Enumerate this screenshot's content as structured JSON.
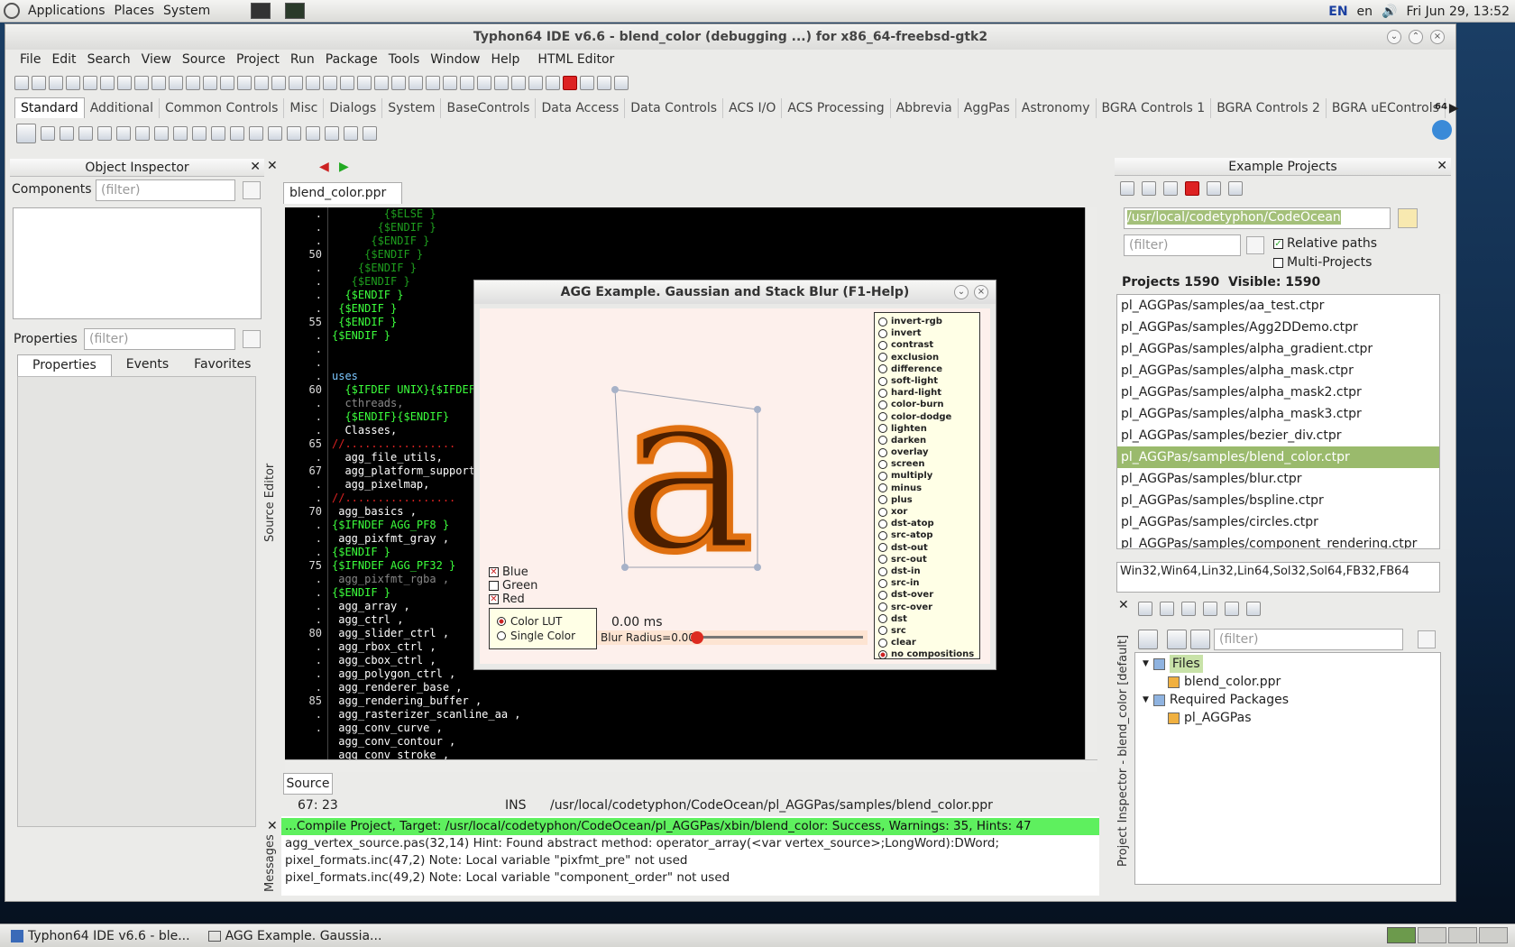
{
  "panel": {
    "menus": [
      "Applications",
      "Places",
      "System"
    ],
    "lang1": "EN",
    "lang2": "en",
    "clock": "Fri Jun 29, 13:52"
  },
  "ide": {
    "title": "Typhon64 IDE v6.6 - blend_color (debugging ...) for x86_64-freebsd-gtk2",
    "menu": [
      "File",
      "Edit",
      "Search",
      "View",
      "Source",
      "Project",
      "Run",
      "Package",
      "Tools",
      "Window",
      "Help",
      "HTML Editor"
    ],
    "palette_tabs": [
      "Standard",
      "Additional",
      "Common Controls",
      "Misc",
      "Dialogs",
      "System",
      "BaseControls",
      "Data Access",
      "Data Controls",
      "ACS I/O",
      "ACS Processing",
      "Abbrevia",
      "AggPas",
      "Astronomy",
      "BGRA Controls 1",
      "BGRA Controls 2",
      "BGRA uEControls"
    ],
    "palette_badge": "64"
  },
  "inspector": {
    "title": "Object Inspector",
    "components_label": "Components",
    "filter_placeholder": "(filter)",
    "properties_label": "Properties",
    "tabs": [
      "Properties",
      "Events",
      "Favorites"
    ]
  },
  "editor": {
    "file_tab": "blend_color.ppr",
    "side_label": "Source Editor",
    "gutter": [
      ".",
      ".",
      ".",
      "50",
      ".",
      ".",
      ".",
      ".",
      "55",
      ".",
      ".",
      ".",
      ".",
      "60",
      ".",
      ".",
      ".",
      "65",
      ".",
      "67",
      ".",
      ".",
      "70",
      ".",
      ".",
      ".",
      "75",
      ".",
      ".",
      ".",
      ".",
      "80",
      ".",
      ".",
      ".",
      ".",
      "85",
      ".",
      "."
    ],
    "lines": [
      {
        "t": "        {$ELSE }",
        "c": "#1e9e1e"
      },
      {
        "t": "       {$ENDIF }",
        "c": "#1e9e1e"
      },
      {
        "t": "      {$ENDIF }",
        "c": "#1e9e1e"
      },
      {
        "t": "     {$ENDIF }",
        "c": "#1e9e1e"
      },
      {
        "t": "    {$ENDIF }",
        "c": "#1e9e1e"
      },
      {
        "t": "   {$ENDIF }",
        "c": "#1e9e1e"
      },
      {
        "t": "  {$ENDIF }",
        "c": "#3cff3c"
      },
      {
        "t": " {$ENDIF }",
        "c": "#3cff3c"
      },
      {
        "t": " {$ENDIF }",
        "c": "#3cff3c"
      },
      {
        "t": "{$ENDIF }",
        "c": "#3cff3c"
      },
      {
        "t": "",
        "c": "#fff"
      },
      {
        "t": "",
        "c": "#fff"
      },
      {
        "t": "uses",
        "c": "#7cc7ff"
      },
      {
        "t": "  {$IFDEF UNIX}{$IFDEF",
        "c": "#3cff3c"
      },
      {
        "t": "  cthreads,",
        "c": "#888"
      },
      {
        "t": "  {$ENDIF}{$ENDIF}",
        "c": "#3cff3c"
      },
      {
        "t": "  Classes,",
        "c": "#fff"
      },
      {
        "t": "//.................",
        "c": "#d22"
      },
      {
        "t": "  agg_file_utils,",
        "c": "#fff"
      },
      {
        "t": "  agg_platform_support",
        "c": "#fff"
      },
      {
        "t": "  agg_pixelmap,",
        "c": "#fff"
      },
      {
        "t": "//.................",
        "c": "#d22"
      },
      {
        "t": " agg_basics ,",
        "c": "#fff"
      },
      {
        "t": "{$IFNDEF AGG_PF8 }",
        "c": "#3cff3c"
      },
      {
        "t": " agg_pixfmt_gray ,",
        "c": "#fff"
      },
      {
        "t": "{$ENDIF }",
        "c": "#3cff3c"
      },
      {
        "t": "{$IFNDEF AGG_PF32 }",
        "c": "#3cff3c"
      },
      {
        "t": " agg_pixfmt_rgba ,",
        "c": "#888"
      },
      {
        "t": "{$ENDIF }",
        "c": "#3cff3c"
      },
      {
        "t": " agg_array ,",
        "c": "#fff"
      },
      {
        "t": " agg_ctrl ,",
        "c": "#fff"
      },
      {
        "t": " agg_slider_ctrl ,",
        "c": "#fff"
      },
      {
        "t": " agg_rbox_ctrl ,",
        "c": "#fff"
      },
      {
        "t": " agg_cbox_ctrl ,",
        "c": "#fff"
      },
      {
        "t": " agg_polygon_ctrl ,",
        "c": "#fff"
      },
      {
        "t": " agg_renderer_base ,",
        "c": "#fff"
      },
      {
        "t": " agg_rendering_buffer ,",
        "c": "#fff"
      },
      {
        "t": " agg_rasterizer_scanline_aa ,",
        "c": "#fff"
      },
      {
        "t": " agg_conv_curve ,",
        "c": "#fff"
      },
      {
        "t": " agg_conv_contour ,",
        "c": "#fff"
      },
      {
        "t": " agg_conv_stroke ,",
        "c": "#fff"
      }
    ],
    "bottom_tab": "Source",
    "status_pos": "67: 23",
    "status_mode": "INS",
    "status_path": "/usr/local/codetyphon/CodeOcean/pl_AGGPas/samples/blend_color.ppr"
  },
  "agg": {
    "title": "AGG Example. Gaussian and Stack Blur (F1-Help)",
    "glyph": "a",
    "channels": [
      {
        "label": "Blue",
        "checked": true
      },
      {
        "label": "Green",
        "checked": false
      },
      {
        "label": "Red",
        "checked": true
      }
    ],
    "modes": [
      {
        "label": "Color LUT",
        "selected": true
      },
      {
        "label": "Single Color",
        "selected": false
      }
    ],
    "time": "0.00  ms",
    "slider_label": "Blur Radius=0.00",
    "blur_value": 0,
    "compositions": [
      "invert-rgb",
      "invert",
      "contrast",
      "exclusion",
      "difference",
      "soft-light",
      "hard-light",
      "color-burn",
      "color-dodge",
      "lighten",
      "darken",
      "overlay",
      "screen",
      "multiply",
      "minus",
      "plus",
      "xor",
      "dst-atop",
      "src-atop",
      "dst-out",
      "src-out",
      "dst-in",
      "src-in",
      "dst-over",
      "src-over",
      "dst",
      "src",
      "clear",
      "no compositions"
    ],
    "selected_composition": "no compositions"
  },
  "examples": {
    "title": "Example Projects",
    "path": "/usr/local/codetyphon/CodeOcean",
    "filter_placeholder": "(filter)",
    "relative_label": "Relative paths",
    "relative_checked": true,
    "multi_label": "Multi-Projects",
    "multi_checked": false,
    "counts": "Projects 1590  Visible: 1590",
    "items": [
      "pl_AGGPas/samples/aa_test.ctpr",
      "pl_AGGPas/samples/Agg2DDemo.ctpr",
      "pl_AGGPas/samples/alpha_gradient.ctpr",
      "pl_AGGPas/samples/alpha_mask.ctpr",
      "pl_AGGPas/samples/alpha_mask2.ctpr",
      "pl_AGGPas/samples/alpha_mask3.ctpr",
      "pl_AGGPas/samples/bezier_div.ctpr",
      "pl_AGGPas/samples/blend_color.ctpr",
      "pl_AGGPas/samples/blur.ctpr",
      "pl_AGGPas/samples/bspline.ctpr",
      "pl_AGGPas/samples/circles.ctpr",
      "pl_AGGPas/samples/component_rendering.ctpr"
    ],
    "selected_index": 7,
    "platforms": "Win32,Win64,Lin32,Lin64,Sol32,Sol64,FB32,FB64"
  },
  "projinsp": {
    "side_label": "Project Inspector - blend_color [default]",
    "filter_placeholder": "(filter)",
    "tree": [
      {
        "label": "Files",
        "level": 0,
        "sel": true
      },
      {
        "label": "blend_color.ppr",
        "level": 1,
        "sel": false
      },
      {
        "label": "Required Packages",
        "level": 0,
        "sel": false
      },
      {
        "label": "pl_AGGPas",
        "level": 1,
        "sel": false
      }
    ]
  },
  "messages": {
    "side_label": "Messages",
    "header": "...Compile Project, Target: /usr/local/codetyphon/CodeOcean/pl_AGGPas/xbin/blend_color: Success, Warnings: 35, Hints: 47",
    "items": [
      "agg_vertex_source.pas(32,14) Hint: Found abstract method: operator_array(<var vertex_source>;LongWord):DWord;",
      "pixel_formats.inc(47,2) Note: Local variable \"pixfmt_pre\" not used",
      "pixel_formats.inc(49,2) Note: Local variable \"component_order\" not used"
    ]
  },
  "taskbar": {
    "tasks": [
      "Typhon64 IDE v6.6 - ble...",
      "AGG Example. Gaussia..."
    ]
  }
}
